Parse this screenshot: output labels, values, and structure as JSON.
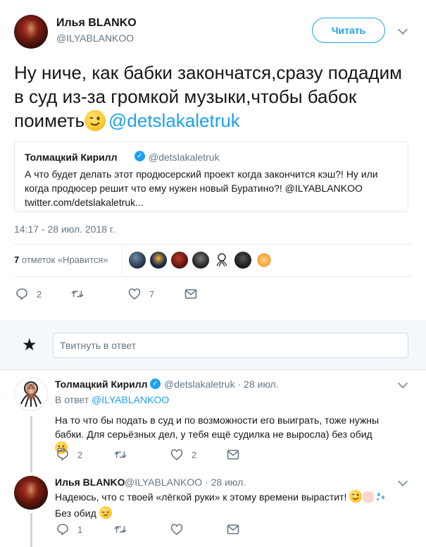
{
  "main_tweet": {
    "author_name": "Илья BLANKO",
    "author_handle": "@ILYABLANKOO",
    "follow_label": "Читать",
    "text": "Ну ниче, как бабки закончатся,сразу подадим в суд из-за громкой музыки,чтобы бабок поиметь",
    "emoji": "winking-face",
    "mention": "@detslakaletruk",
    "timestamp": "14:17 - 28 июл. 2018 г."
  },
  "quoted_tweet": {
    "author_name": "Толмацкий Кирилл",
    "verified": true,
    "author_handle": "@detslakaletruk",
    "text": "А что будет делать этот продюсерский проект когда закончится кэш?! Ну или когда продюсер решит что ему нужен новый Буратино?! @ILYABLANKOO twitter.com/detslakaletruk..."
  },
  "likes": {
    "count": "7",
    "label": "отметок «Нравится»"
  },
  "actions": {
    "reply_count": "2",
    "retweet_count": "",
    "like_count": "7"
  },
  "reply_box": {
    "placeholder": "Твитнуть в ответ"
  },
  "replies": [
    {
      "author_name": "Толмацкий Кирилл",
      "verified": true,
      "meta": "@detslakaletruk · 28 июл.",
      "reply_to_label": "В ответ",
      "reply_to_handle": "@ILYABLANKOO",
      "text": "На то что бы подать в суд и по возможности его выиграть, тоже нужны бабки. Для серьёзных дел, у тебя ещё судилка не выросла) без обид",
      "reply_count": "2",
      "retweet_count": "",
      "like_count": "2"
    },
    {
      "author_name": "Илья BLANKO",
      "meta": "@ILYABLANKOO · 28 июл.",
      "text_line1": "Надеюсь, что  с твоей «лёгкой руки» к этому времени вырастит!",
      "text_line2": "Без обид",
      "reply_count": "1",
      "retweet_count": "",
      "like_count": ""
    }
  ],
  "colors": {
    "accent": "#1da1f2",
    "text": "#14171a",
    "muted": "#657786",
    "border": "#e6ecf0"
  }
}
